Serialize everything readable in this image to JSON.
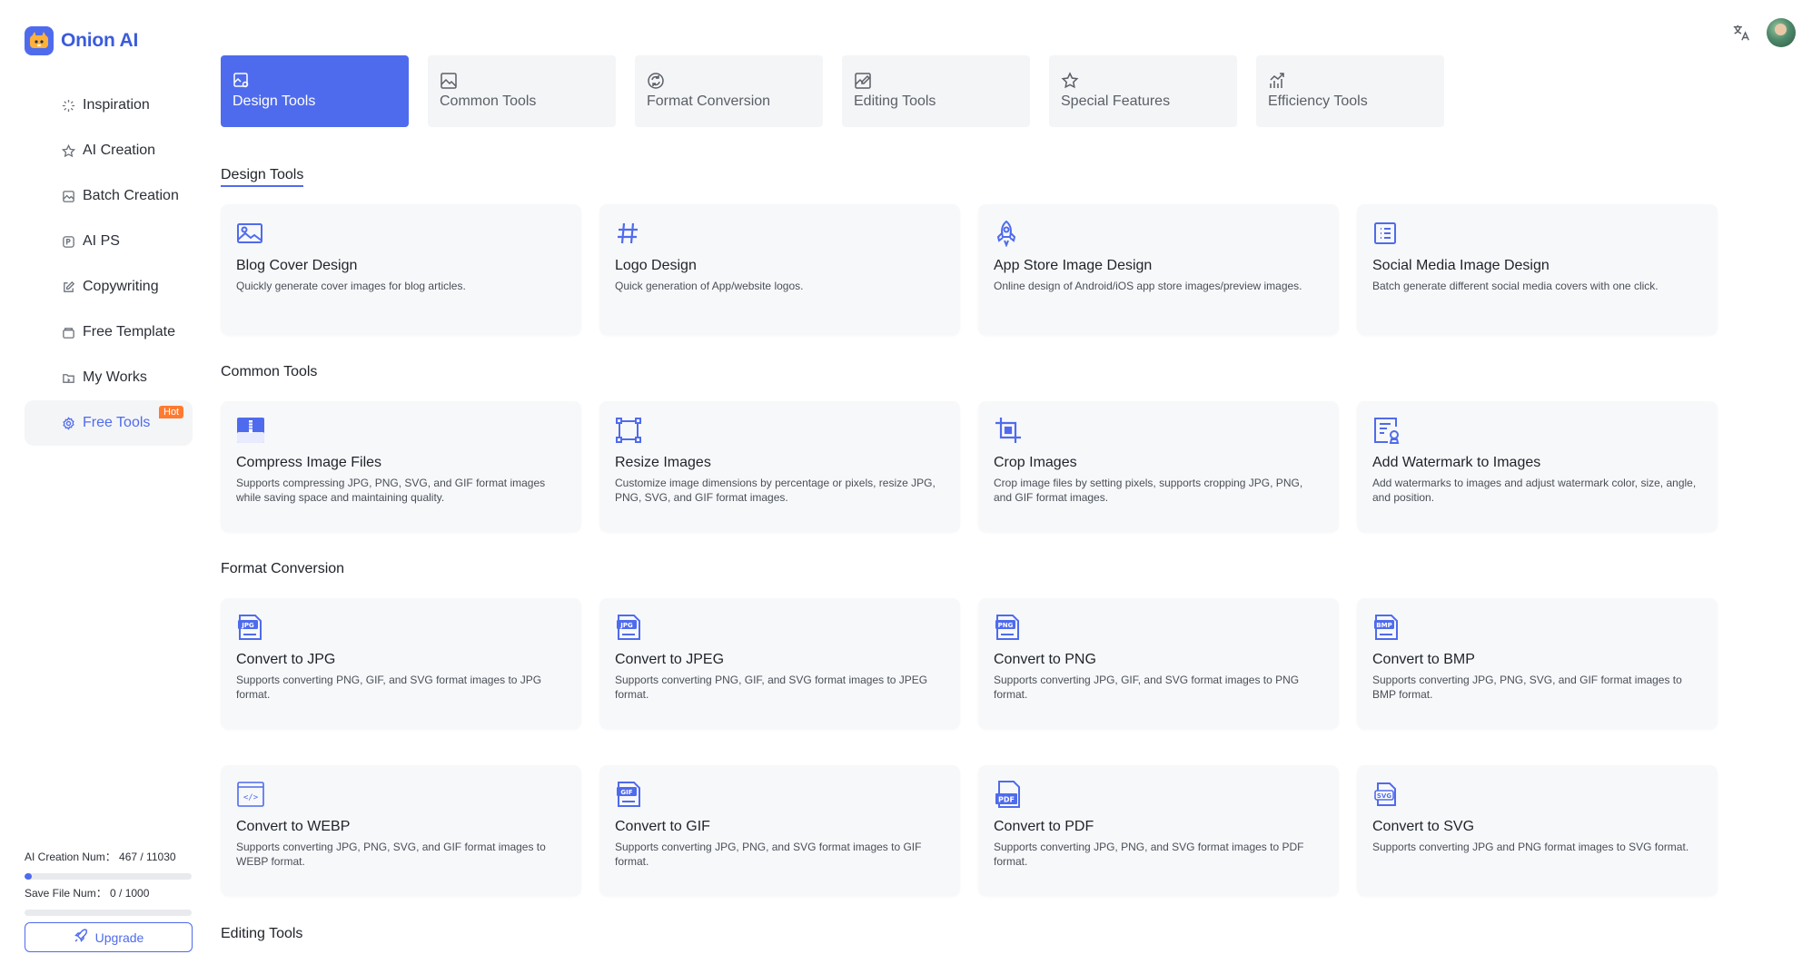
{
  "brand": {
    "name": "Onion AI"
  },
  "sidebar": {
    "items": [
      {
        "label": "Inspiration",
        "icon": "sparkle-icon",
        "active": false
      },
      {
        "label": "AI Creation",
        "icon": "star-icon",
        "active": false
      },
      {
        "label": "Batch Creation",
        "icon": "image-stack-icon",
        "active": false
      },
      {
        "label": "AI PS",
        "icon": "ps-icon",
        "active": false
      },
      {
        "label": "Copywriting",
        "icon": "edit-icon",
        "active": false
      },
      {
        "label": "Free Template",
        "icon": "template-icon",
        "active": false
      },
      {
        "label": "My Works",
        "icon": "folder-icon",
        "active": false
      },
      {
        "label": "Free Tools",
        "icon": "gear-icon",
        "active": true,
        "badge": "Hot"
      }
    ],
    "quota": {
      "ai_creation_label": "AI Creation Num： 467 / 11030",
      "ai_creation_fraction": 0.042,
      "save_file_label": "Save File Num： 0 / 1000",
      "save_file_fraction": 0
    },
    "upgrade_label": "Upgrade"
  },
  "tabs": [
    {
      "label": "Design Tools",
      "icon": "design-icon",
      "active": true
    },
    {
      "label": "Common Tools",
      "icon": "image-icon",
      "active": false
    },
    {
      "label": "Format Conversion",
      "icon": "convert-icon",
      "active": false
    },
    {
      "label": "Editing Tools",
      "icon": "edit-image-icon",
      "active": false
    },
    {
      "label": "Special Features",
      "icon": "star-icon",
      "active": false
    },
    {
      "label": "Efficiency Tools",
      "icon": "chart-icon",
      "active": false
    }
  ],
  "sections": {
    "design": {
      "title": "Design Tools",
      "cards": [
        {
          "title": "Blog Cover Design",
          "desc": "Quickly generate cover images for blog articles.",
          "icon": "picture-icon"
        },
        {
          "title": "Logo Design",
          "desc": "Quick generation of App/website logos.",
          "icon": "hash-icon"
        },
        {
          "title": "App Store Image Design",
          "desc": "Online design of Android/iOS app store images/preview images.",
          "icon": "rocket-icon"
        },
        {
          "title": "Social Media Image Design",
          "desc": "Batch generate different social media covers with one click.",
          "icon": "list-icon"
        }
      ]
    },
    "common": {
      "title": "Common Tools",
      "cards": [
        {
          "title": "Compress Image Files",
          "desc": "Supports compressing JPG, PNG, SVG, and GIF format images while saving space and maintaining quality.",
          "icon": "compress-icon"
        },
        {
          "title": "Resize Images",
          "desc": "Customize image dimensions by percentage or pixels, resize JPG, PNG, SVG, and GIF format images.",
          "icon": "resize-icon"
        },
        {
          "title": "Crop Images",
          "desc": "Crop image files by setting pixels, supports cropping JPG, PNG, and GIF format images.",
          "icon": "crop-icon"
        },
        {
          "title": "Add Watermark to Images",
          "desc": "Add watermarks to images and adjust watermark color, size, angle, and position.",
          "icon": "watermark-icon"
        }
      ]
    },
    "format": {
      "title": "Format Conversion",
      "cards": [
        {
          "title": "Convert to JPG",
          "desc": "Supports converting PNG, GIF, and SVG format images to JPG format.",
          "icon": "jpg-icon",
          "tag": "JPG"
        },
        {
          "title": "Convert to JPEG",
          "desc": "Supports converting PNG, GIF, and SVG format images to JPEG format.",
          "icon": "jpeg-icon",
          "tag": "JPG"
        },
        {
          "title": "Convert to PNG",
          "desc": "Supports converting JPG, GIF, and SVG format images to PNG format.",
          "icon": "png-icon",
          "tag": "PNG"
        },
        {
          "title": "Convert to BMP",
          "desc": "Supports converting JPG, PNG, SVG, and GIF format images to BMP format.",
          "icon": "bmp-icon",
          "tag": "BMP"
        },
        {
          "title": "Convert to WEBP",
          "desc": "Supports converting JPG, PNG, SVG, and GIF format images to WEBP format.",
          "icon": "webp-icon",
          "tag": "</>"
        },
        {
          "title": "Convert to GIF",
          "desc": "Supports converting JPG, PNG, and SVG format images to GIF format.",
          "icon": "gif-icon",
          "tag": "GIF"
        },
        {
          "title": "Convert to PDF",
          "desc": "Supports converting JPG, PNG, and SVG format images to PDF format.",
          "icon": "pdf-icon",
          "tag": "PDF"
        },
        {
          "title": "Convert to SVG",
          "desc": "Supports converting JPG and PNG format images to SVG format.",
          "icon": "svg-icon",
          "tag": "SVG"
        }
      ]
    },
    "editing": {
      "title": "Editing Tools"
    }
  },
  "colors": {
    "accent": "#4f6bed",
    "badge": "#ff7a2f",
    "card_bg": "#f7f8fa"
  }
}
